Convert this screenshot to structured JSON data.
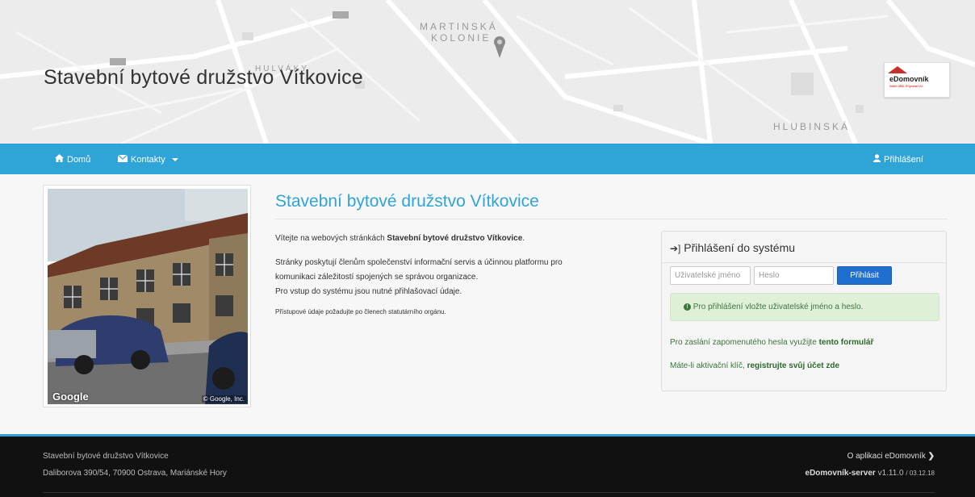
{
  "header": {
    "site_title": "Stavební bytové družstvo Vítkovice",
    "map_labels": [
      "MARTINSKÁ",
      "KOLONIE",
      "HULVÁKY",
      "HLUBINSKÁ"
    ],
    "logo_name": "eDomovník",
    "logo_sub": "WAM 3BD SSportal UX"
  },
  "navbar": {
    "home_label": "Domů",
    "contacts_label": "Kontakty",
    "login_label": "Přihlášení"
  },
  "content": {
    "title": "Stavební bytové družstvo Vítkovice",
    "welcome_prefix": "Vítejte na webových stránkách ",
    "welcome_bold": "Stavební bytové družstvo Vítkovice",
    "welcome_suffix": ".",
    "para2_line1": "Stránky poskytují členům společenství informační servis a účinnou platformu pro",
    "para2_line2": "komunikaci záležitostí spojených se správou organizace.",
    "para3": "Pro vstup do systému jsou nutné přihlašovací údaje.",
    "para4": "Přístupové údaje požadujte po členech statutárního orgánu.",
    "photo_google": "Google",
    "photo_copyright": "© Google, Inc."
  },
  "login": {
    "heading": "Přihlášení do systému",
    "username_placeholder": "Uživatelské jméno",
    "password_placeholder": "Heslo",
    "submit_label": "Přihlásit",
    "alert": "Pro přihlášení vložte uživatelské jméno a heslo.",
    "forgot_prefix": "Pro zaslání zapomenutého hesla využijte ",
    "forgot_link": "tento formulář",
    "activation_prefix": "Máte-li aktivační klíč, ",
    "activation_link": "registrujte svůj účet zde"
  },
  "footer": {
    "org_name": "Stavební bytové družstvo Vítkovice",
    "address": "Daliborova 390/54, 70900 Ostrava, Mariánské Hory",
    "about_link": "O aplikaci eDomovník",
    "server_name": "eDomovník-server",
    "version": "v1.11.0",
    "build_date": "/ 03.12.18"
  }
}
